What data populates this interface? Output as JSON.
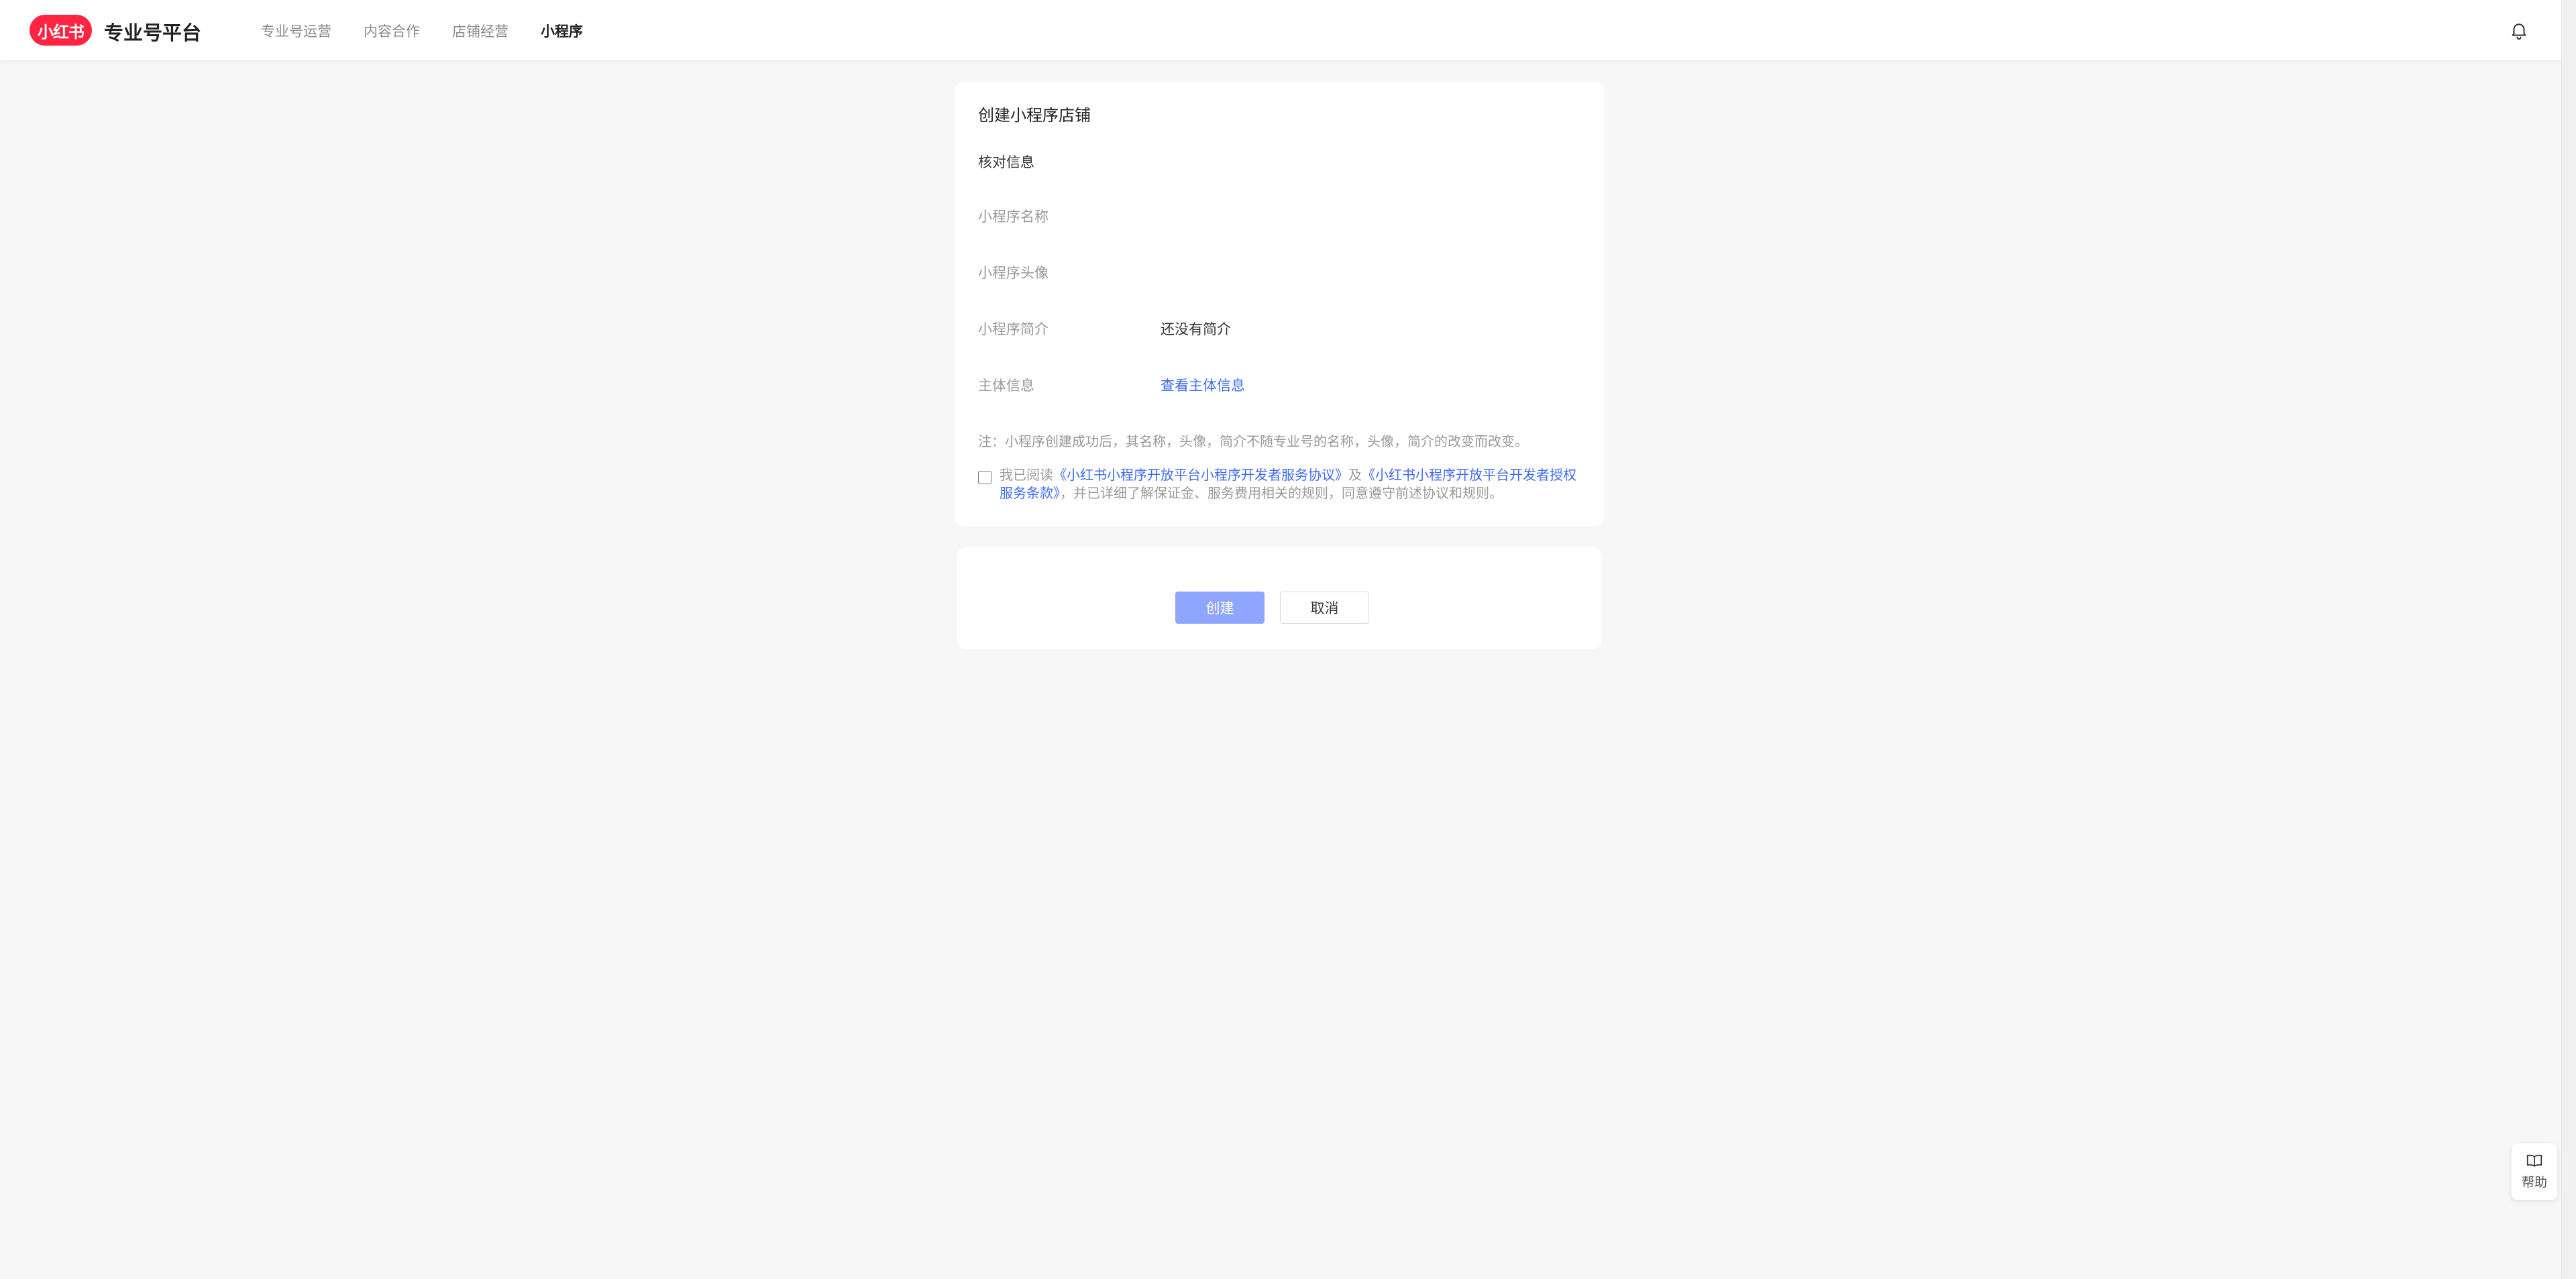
{
  "header": {
    "logo_text": "小红书",
    "brand_title": "专业号平台",
    "nav": [
      {
        "label": "专业号运营",
        "active": false
      },
      {
        "label": "内容合作",
        "active": false
      },
      {
        "label": "店铺经营",
        "active": false
      },
      {
        "label": "小程序",
        "active": true
      }
    ],
    "bell_icon": "bell-icon"
  },
  "form": {
    "title": "创建小程序店铺",
    "section_title": "核对信息",
    "rows": [
      {
        "label": "小程序名称",
        "value": ""
      },
      {
        "label": "小程序头像",
        "value": ""
      },
      {
        "label": "小程序简介",
        "value": "还没有简介"
      },
      {
        "label": "主体信息",
        "link": "查看主体信息"
      }
    ],
    "note": "注：小程序创建成功后，其名称，头像，简介不随专业号的名称，头像，简介的改变而改变。",
    "agreement": {
      "checked": false,
      "prefix": "我已阅读",
      "link1": "《小红书小程序开放平台小程序开发者服务协议》",
      "and": "及",
      "link2": "《小红书小程序开放平台开发者授权服务条款》",
      "suffix": "，并已详细了解保证金、服务费用相关的规则，同意遵守前述协议和规则。"
    }
  },
  "actions": {
    "create_label": "创建",
    "cancel_label": "取消"
  },
  "help": {
    "label": "帮助",
    "icon": "book-icon"
  },
  "colors": {
    "brand": "#ff2442",
    "link": "#3d6af0",
    "primary_button": "#8fa6ff",
    "background": "#f7f7f8"
  }
}
